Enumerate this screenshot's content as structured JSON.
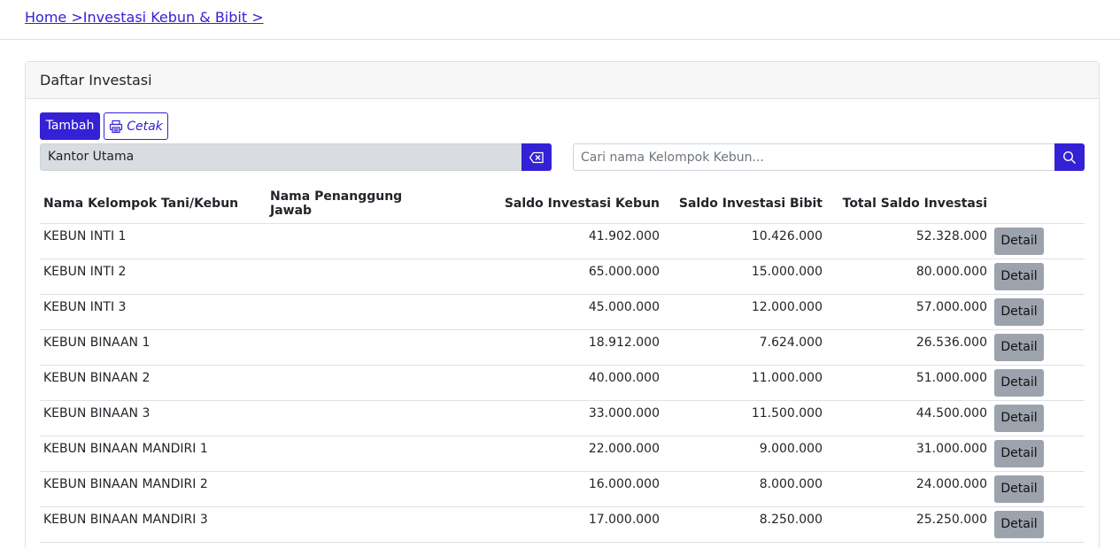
{
  "breadcrumb": {
    "text": "Home >Investasi Kebun & Bibit >"
  },
  "card": {
    "title": "Daftar Investasi"
  },
  "toolbar": {
    "add_label": "Tambah",
    "print_label": "Cetak"
  },
  "branch": {
    "value": "Kantor Utama"
  },
  "search": {
    "placeholder": "Cari nama Kelompok Kebun..."
  },
  "table": {
    "headers": {
      "group_name": "Nama Kelompok Tani/Kebun",
      "person": "Nama Penanggung Jawab",
      "kebun": "Saldo Investasi Kebun",
      "bibit": "Saldo Investasi Bibit",
      "total": "Total Saldo Investasi"
    },
    "detail_label": "Detail",
    "rows": [
      {
        "name": "KEBUN INTI 1",
        "person": "",
        "kebun": "41.902.000",
        "bibit": "10.426.000",
        "total": "52.328.000"
      },
      {
        "name": "KEBUN INTI 2",
        "person": "",
        "kebun": "65.000.000",
        "bibit": "15.000.000",
        "total": "80.000.000"
      },
      {
        "name": "KEBUN INTI 3",
        "person": "",
        "kebun": "45.000.000",
        "bibit": "12.000.000",
        "total": "57.000.000"
      },
      {
        "name": "KEBUN BINAAN 1",
        "person": "",
        "kebun": "18.912.000",
        "bibit": "7.624.000",
        "total": "26.536.000"
      },
      {
        "name": "KEBUN BINAAN 2",
        "person": "",
        "kebun": "40.000.000",
        "bibit": "11.000.000",
        "total": "51.000.000"
      },
      {
        "name": "KEBUN BINAAN 3",
        "person": "",
        "kebun": "33.000.000",
        "bibit": "11.500.000",
        "total": "44.500.000"
      },
      {
        "name": "KEBUN BINAAN MANDIRI 1",
        "person": "",
        "kebun": "22.000.000",
        "bibit": "9.000.000",
        "total": "31.000.000"
      },
      {
        "name": "KEBUN BINAAN MANDIRI 2",
        "person": "",
        "kebun": "16.000.000",
        "bibit": "8.000.000",
        "total": "24.000.000"
      },
      {
        "name": "KEBUN BINAAN MANDIRI 3",
        "person": "",
        "kebun": "17.000.000",
        "bibit": "8.250.000",
        "total": "25.250.000"
      }
    ]
  },
  "icons": {
    "print": "printer-icon",
    "clear": "backspace-icon",
    "search": "search-icon"
  },
  "colors": {
    "primary": "#3421d6",
    "detail_button": "#9ca3ad"
  }
}
